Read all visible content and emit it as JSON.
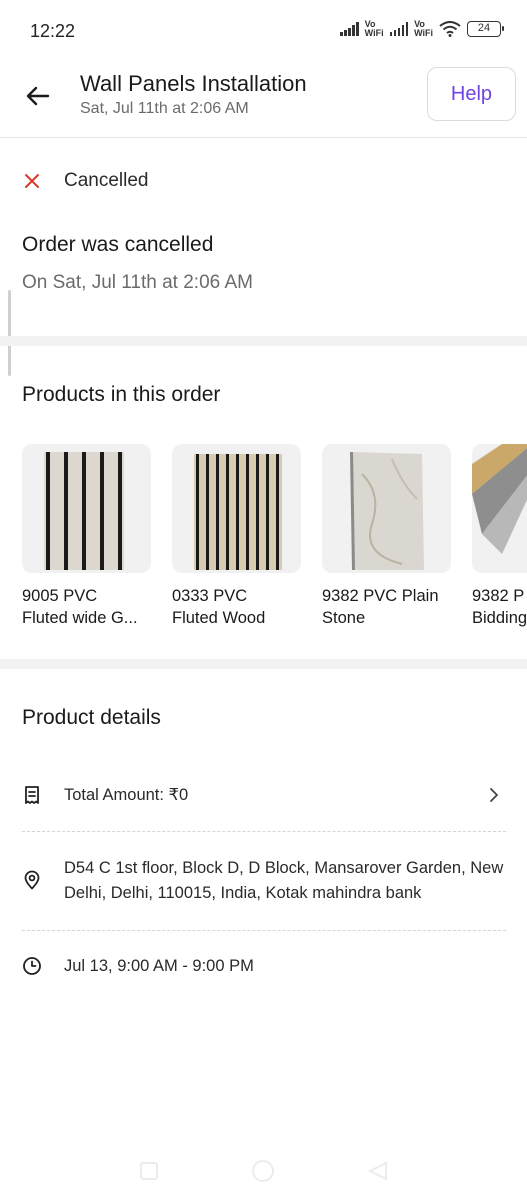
{
  "status_bar": {
    "time": "12:22",
    "vowifi_label": "Vo\nWiFi",
    "battery": "24"
  },
  "header": {
    "title": "Wall Panels Installation",
    "subtitle": "Sat, Jul 11th at 2:06 AM",
    "help_label": "Help",
    "accent_color": "#6e42e5"
  },
  "order_status": {
    "status_label": "Cancelled",
    "title": "Order was cancelled",
    "subtitle": "On Sat, Jul 11th at 2:06 AM",
    "status_color": "#d93a2b"
  },
  "products": {
    "section_title": "Products in this order",
    "items": [
      {
        "line1": "9005 PVC",
        "line2": "Fluted wide G..."
      },
      {
        "line1": "0333 PVC",
        "line2": "Fluted Wood"
      },
      {
        "line1": "9382 PVC Plain",
        "line2": "Stone"
      },
      {
        "line1": "9382 P",
        "line2": "Bidding"
      }
    ]
  },
  "product_details": {
    "section_title": "Product details",
    "total_amount": "Total Amount: ₹0",
    "address": "D54 C 1st floor, Block D, D Block, Mansarover Garden, New Delhi, Delhi, 110015, India, Kotak mahindra bank",
    "schedule": "Jul 13, 9:00 AM - 9:00 PM"
  }
}
